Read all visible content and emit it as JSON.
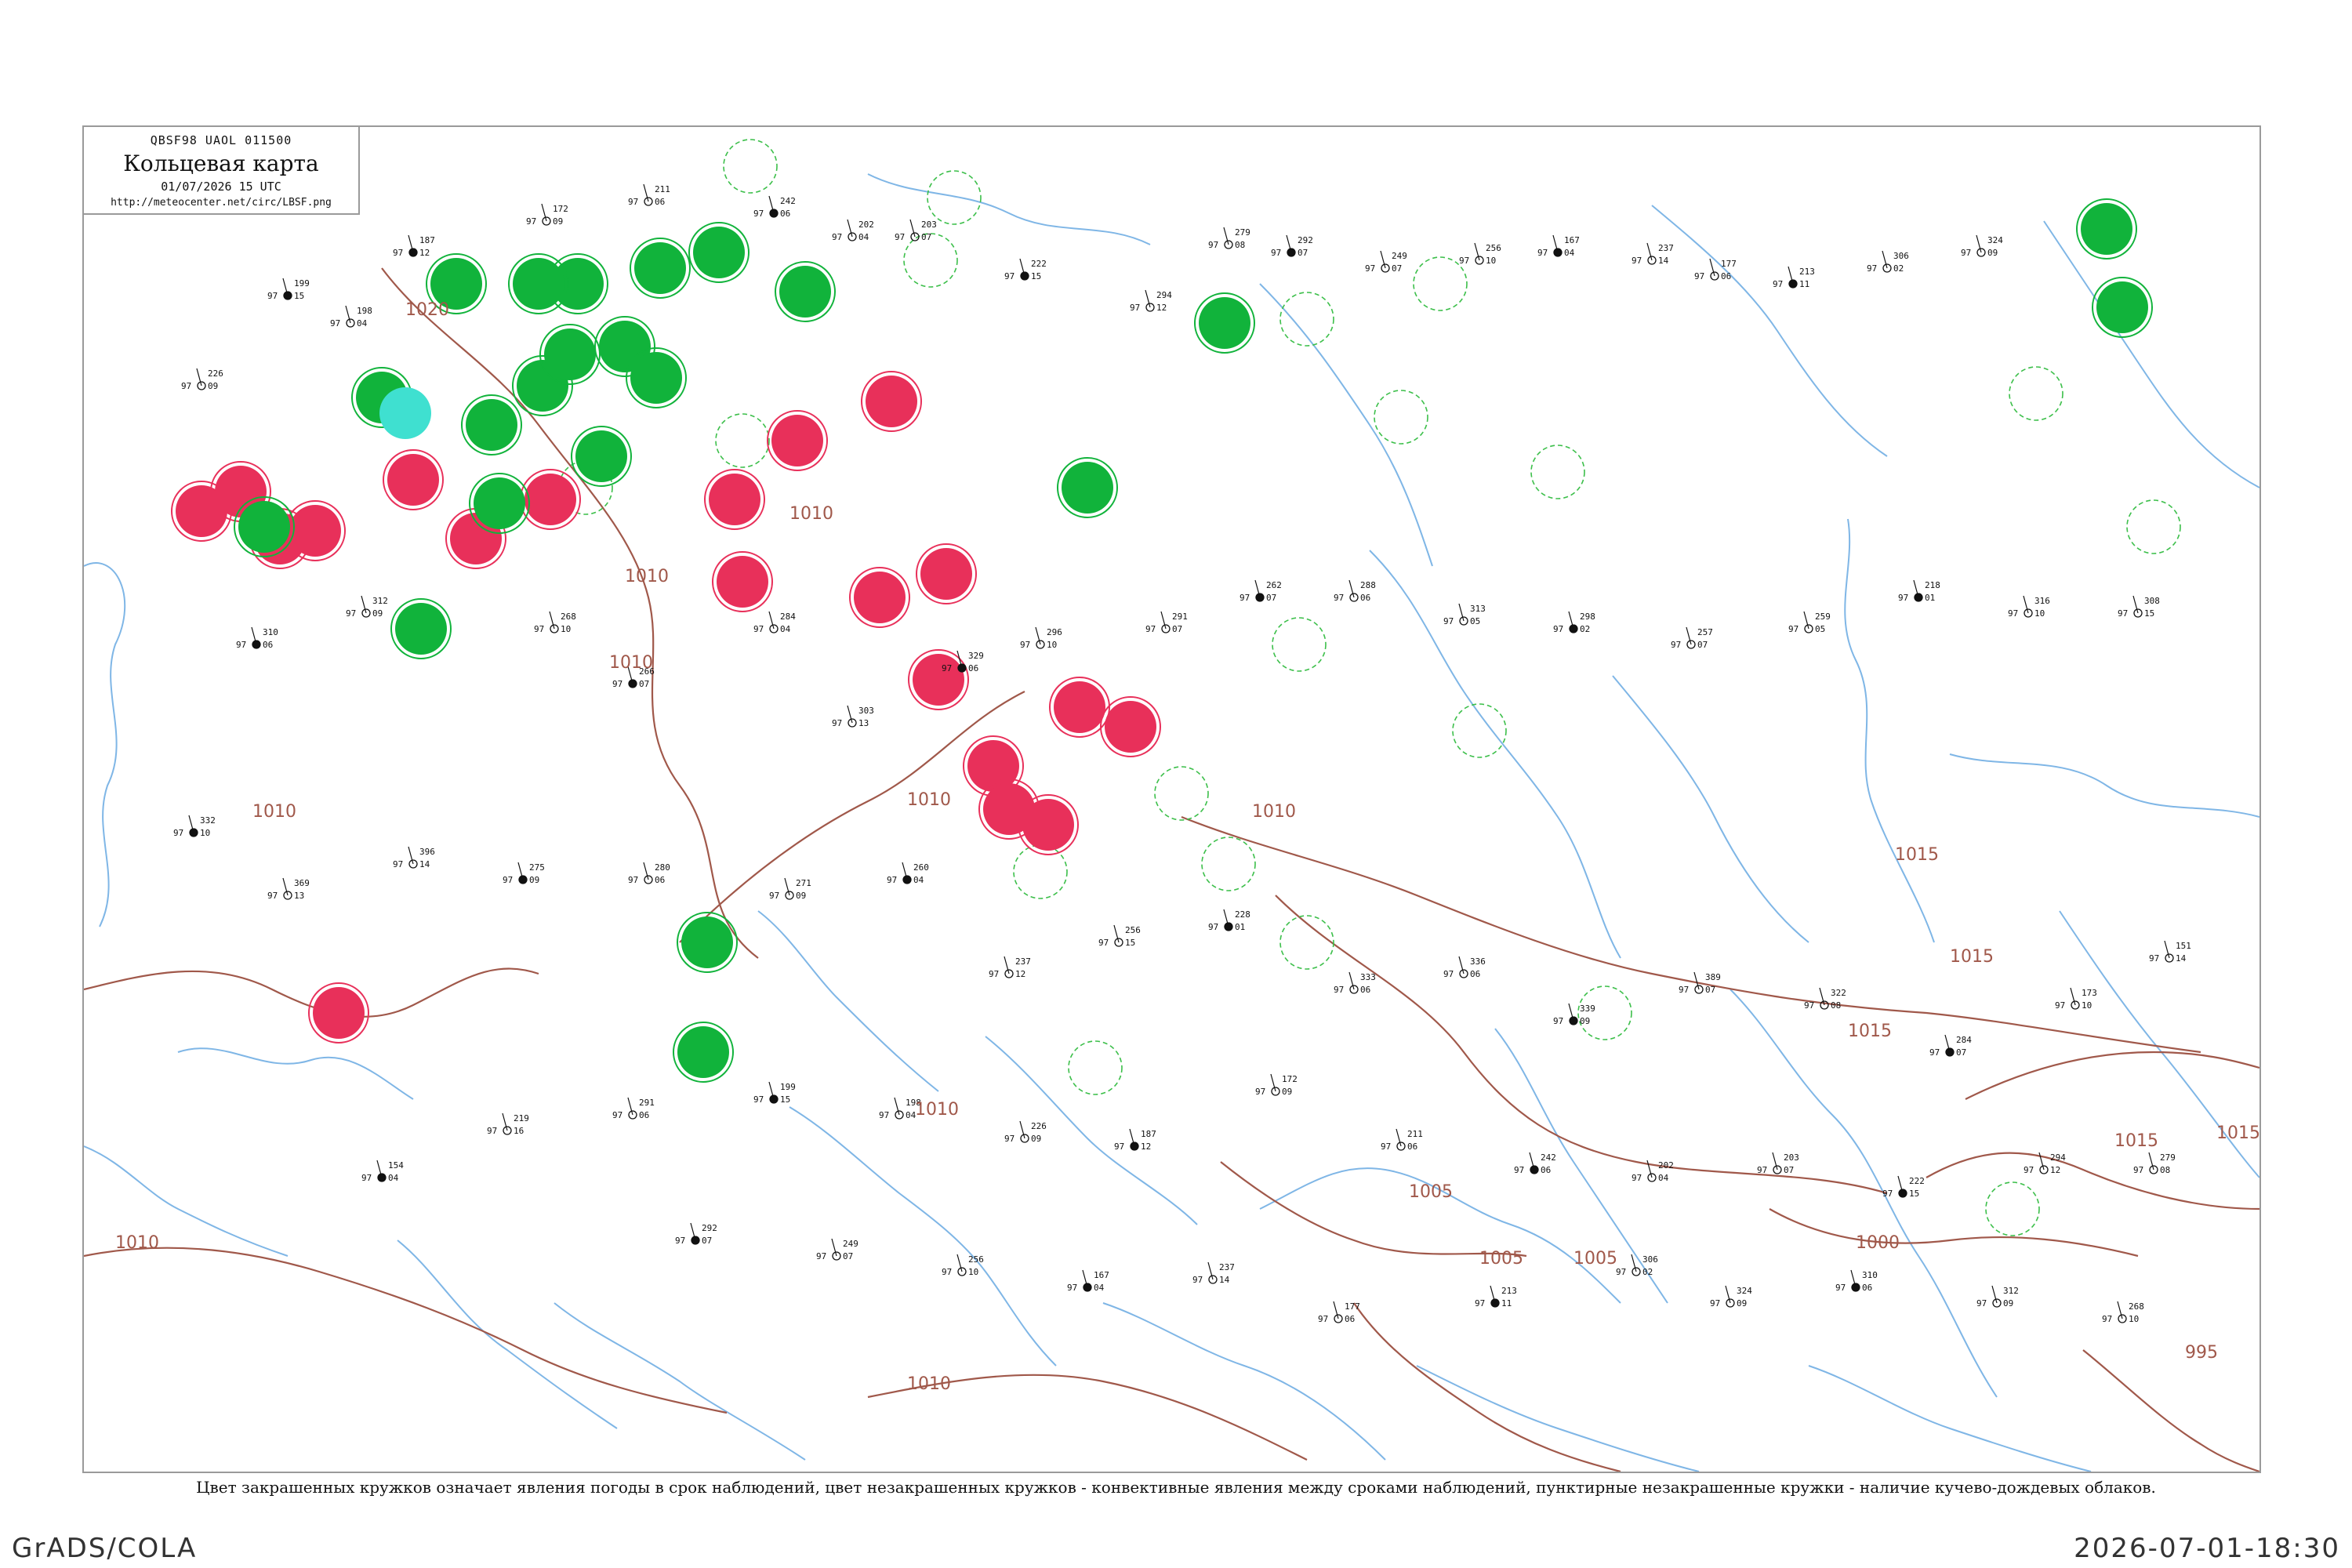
{
  "header": {
    "code": "QBSF98  UAOL  011500",
    "title": "Кольцевая карта",
    "date": "01/07/2026 15 UTC",
    "url": "http://meteocenter.net/circ/LBSF.png"
  },
  "legend_note": "Цвет закрашенных кружков означает явления погоды в срок наблюдений, цвет незакрашенных кружков - конвективные явления между сроками наблюдений, пунктирные незакрашенные кружки - наличие кучево-дождевых облаков.",
  "footer": {
    "left": "GrADS/COLA",
    "right": "2026-07-01-18:30"
  },
  "colors": {
    "isobar": "#a0584a",
    "water": "#7fb6e6",
    "thunder_red": "#e8305a",
    "rain_green": "#11b33b",
    "shower_cyan": "#3fe0d0",
    "cb_dashed": "#3cbf4a",
    "frame": "#9a9a9a"
  },
  "isobar_labels": [
    "1020",
    "1010",
    "1010",
    "1010",
    "1010",
    "1010",
    "1015",
    "1015",
    "1015",
    "1015",
    "1010",
    "1005",
    "1005",
    "1005",
    "1000",
    "995",
    "1010",
    "1015",
    "1010",
    "1010"
  ],
  "markers": {
    "red_filled": 20,
    "green_filled": 22,
    "cyan_filled": 1
  },
  "stations": [
    {
      "p": "199",
      "t": "97",
      "id": "15"
    },
    {
      "p": "198",
      "t": "97",
      "id": "04"
    },
    {
      "p": "226",
      "t": "97",
      "id": "09"
    },
    {
      "p": "187",
      "t": "97",
      "id": "12"
    },
    {
      "p": "172",
      "t": "97",
      "id": "09"
    },
    {
      "p": "211",
      "t": "97",
      "id": "06"
    },
    {
      "p": "242",
      "t": "97",
      "id": "06"
    },
    {
      "p": "202",
      "t": "97",
      "id": "04"
    },
    {
      "p": "203",
      "t": "97",
      "id": "07"
    },
    {
      "p": "222",
      "t": "97",
      "id": "15"
    },
    {
      "p": "294",
      "t": "97",
      "id": "12"
    },
    {
      "p": "279",
      "t": "97",
      "id": "08"
    },
    {
      "p": "292",
      "t": "97",
      "id": "07"
    },
    {
      "p": "249",
      "t": "97",
      "id": "07"
    },
    {
      "p": "256",
      "t": "97",
      "id": "10"
    },
    {
      "p": "167",
      "t": "97",
      "id": "04"
    },
    {
      "p": "237",
      "t": "97",
      "id": "14"
    },
    {
      "p": "177",
      "t": "97",
      "id": "06"
    },
    {
      "p": "213",
      "t": "97",
      "id": "11"
    },
    {
      "p": "306",
      "t": "97",
      "id": "02"
    },
    {
      "p": "324",
      "t": "97",
      "id": "09"
    },
    {
      "p": "310",
      "t": "97",
      "id": "06"
    },
    {
      "p": "312",
      "t": "97",
      "id": "09"
    },
    {
      "p": "268",
      "t": "97",
      "id": "10"
    },
    {
      "p": "266",
      "t": "97",
      "id": "07"
    },
    {
      "p": "284",
      "t": "97",
      "id": "04"
    },
    {
      "p": "303",
      "t": "97",
      "id": "13"
    },
    {
      "p": "329",
      "t": "97",
      "id": "06"
    },
    {
      "p": "296",
      "t": "97",
      "id": "10"
    },
    {
      "p": "291",
      "t": "97",
      "id": "07"
    },
    {
      "p": "262",
      "t": "97",
      "id": "07"
    },
    {
      "p": "288",
      "t": "97",
      "id": "06"
    },
    {
      "p": "313",
      "t": "97",
      "id": "05"
    },
    {
      "p": "298",
      "t": "97",
      "id": "02"
    },
    {
      "p": "257",
      "t": "97",
      "id": "07"
    },
    {
      "p": "259",
      "t": "97",
      "id": "05"
    },
    {
      "p": "218",
      "t": "97",
      "id": "01"
    },
    {
      "p": "316",
      "t": "97",
      "id": "10"
    },
    {
      "p": "308",
      "t": "97",
      "id": "15"
    },
    {
      "p": "332",
      "t": "97",
      "id": "10"
    },
    {
      "p": "369",
      "t": "97",
      "id": "13"
    },
    {
      "p": "396",
      "t": "97",
      "id": "14"
    },
    {
      "p": "275",
      "t": "97",
      "id": "09"
    },
    {
      "p": "280",
      "t": "97",
      "id": "06"
    },
    {
      "p": "271",
      "t": "97",
      "id": "09"
    },
    {
      "p": "260",
      "t": "97",
      "id": "04"
    },
    {
      "p": "237",
      "t": "97",
      "id": "12"
    },
    {
      "p": "256",
      "t": "97",
      "id": "15"
    },
    {
      "p": "228",
      "t": "97",
      "id": "01"
    },
    {
      "p": "333",
      "t": "97",
      "id": "06"
    },
    {
      "p": "336",
      "t": "97",
      "id": "06"
    },
    {
      "p": "339",
      "t": "97",
      "id": "09"
    },
    {
      "p": "389",
      "t": "97",
      "id": "07"
    },
    {
      "p": "322",
      "t": "97",
      "id": "08"
    },
    {
      "p": "284",
      "t": "97",
      "id": "07"
    },
    {
      "p": "173",
      "t": "97",
      "id": "10"
    },
    {
      "p": "151",
      "t": "97",
      "id": "14"
    },
    {
      "p": "154",
      "t": "97",
      "id": "04"
    },
    {
      "p": "219",
      "t": "97",
      "id": "16"
    },
    {
      "p": "291",
      "t": "97",
      "id": "06"
    }
  ]
}
